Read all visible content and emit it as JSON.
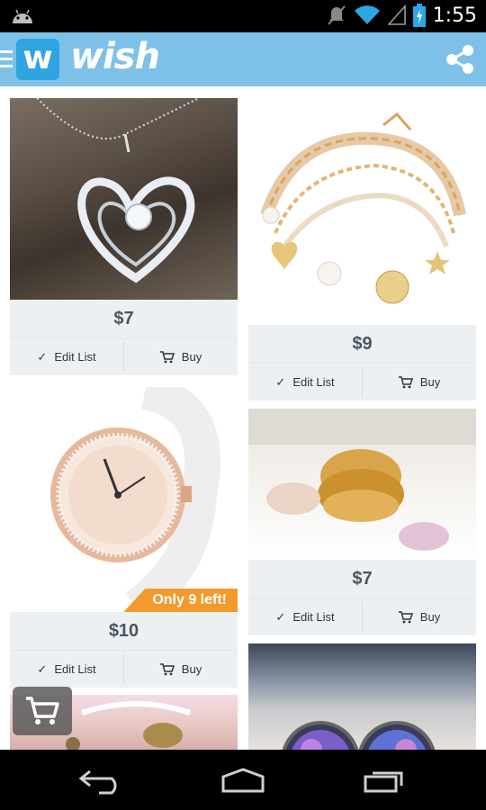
{
  "status_bar": {
    "time": "1:55",
    "icons": [
      "android-icon",
      "mute-icon",
      "wifi-icon",
      "signal-icon",
      "battery-charging-icon"
    ]
  },
  "app_bar": {
    "logo_letter": "w",
    "brand": "wish",
    "icons": [
      "menu-icon",
      "share-icon"
    ]
  },
  "products": [
    {
      "price": "$7",
      "edit_label": "Edit List",
      "buy_label": "Buy",
      "image": "heart-necklace"
    },
    {
      "price": "$9",
      "edit_label": "Edit List",
      "buy_label": "Buy",
      "image": "charm-bracelet"
    },
    {
      "price": "$10",
      "edit_label": "Edit List",
      "buy_label": "Buy",
      "image": "rose-gold-watch",
      "badge": "Only 9 left!"
    },
    {
      "price": "$7",
      "edit_label": "Edit List",
      "buy_label": "Buy",
      "image": "best-friends-rings"
    },
    {
      "image": "bracelet-partial"
    },
    {
      "image": "galaxy-earrings"
    }
  ],
  "cart_fab": {
    "icon": "cart-icon"
  },
  "nav_bar": {
    "icons": [
      "back-icon",
      "home-icon",
      "recent-apps-icon"
    ]
  },
  "colors": {
    "app_bar": "#7ec1e8",
    "logo_box": "#2fa4e0",
    "card_bg": "#ecf0f3",
    "badge": "#f39a2c"
  }
}
